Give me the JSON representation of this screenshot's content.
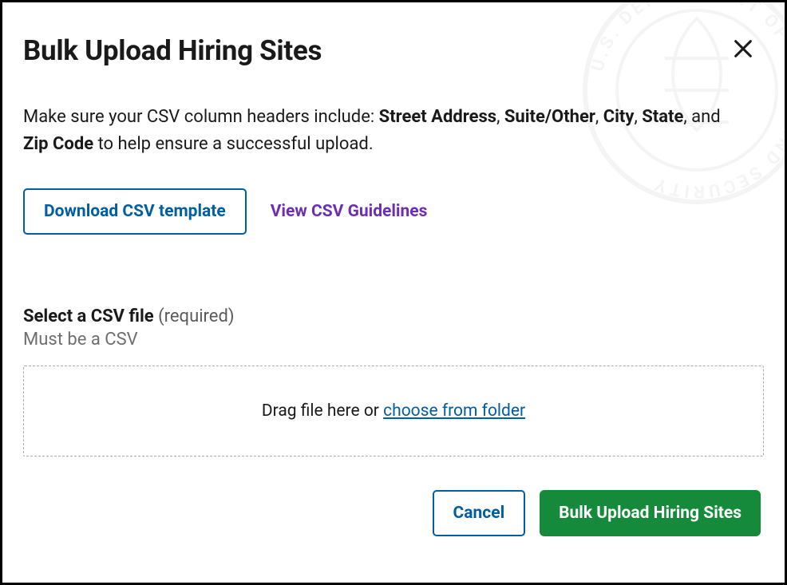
{
  "title": "Bulk Upload Hiring Sites",
  "intro": {
    "lead": "Make sure your CSV column headers include: ",
    "fields": [
      "Street Address",
      "Suite/Other",
      "City",
      "State"
    ],
    "connector": ", ",
    "and": ", and ",
    "last_field": "Zip Code",
    "trail": " to help ensure a successful upload."
  },
  "actions": {
    "download_label": "Download CSV template",
    "guidelines_label": "View CSV Guidelines"
  },
  "file": {
    "label_bold": "Select a CSV file",
    "label_req": " (required)",
    "hint": "Must be a CSV",
    "drop_text": "Drag file here or ",
    "choose_text": "choose from folder"
  },
  "footer": {
    "cancel_label": "Cancel",
    "submit_label": "Bulk Upload Hiring Sites"
  },
  "watermark": "U.S. DEPARTMENT OF HOMELAND SECURITY"
}
